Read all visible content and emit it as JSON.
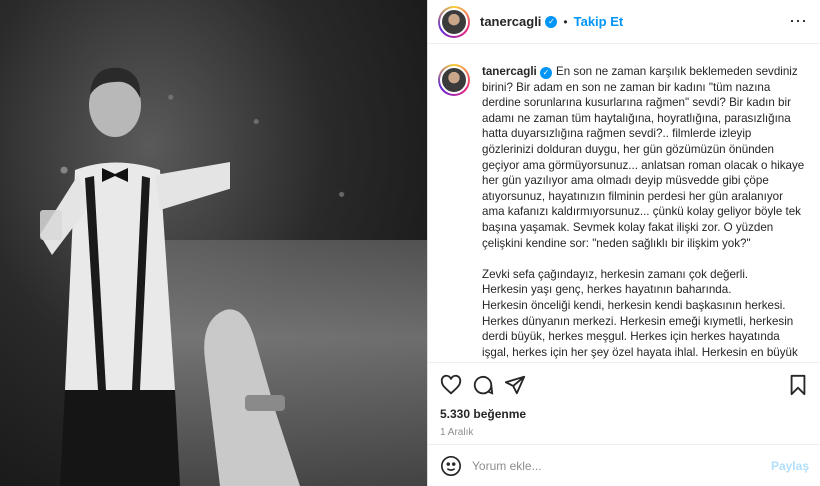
{
  "post": {
    "username": "tanercagli",
    "follow_label": "Takip Et",
    "dot": "•",
    "more": "⋯",
    "caption": "En son ne zaman karşılık beklemeden sevdiniz birini? Bir adam en son ne zaman bir kadını \"tüm nazına derdine sorunlarına kusurlarına rağmen\" sevdi? Bir kadın bir adamı ne zaman tüm haytalığına, hoyratlığına, parasızlığına hatta duyarsızlığına rağmen sevdi?.. filmlerde izleyip gözlerinizi dolduran duygu, her gün gözümüzün önünden geçiyor ama görmüyorsunuz... anlatsan roman olacak o hikaye her gün yazılıyor ama olmadı deyip müsvedde gibi çöpe atıyorsunuz, hayatınızın filminin perdesi her gün aralanıyor ama kafanızı kaldırmıyorsunuz... çünkü kolay geliyor böyle tek başına yaşamak. Sevmek kolay fakat ilişki zor. O yüzden çelişkini kendine sor: \"neden sağlıklı bir ilişkim yok?\"\n\nZevki sefa çağındayız, herkesin zamanı çok değerli.\nHerkesin yaşı genç, herkes hayatının baharında.\nHerkesin önceliği kendi, herkesin kendi başkasının herkesi.\nHerkes dünyanın merkezi. Herkesin emeği kıymetli, herkesin derdi büyük, herkes meşgul. Herkes için herkes hayatında işgal, herkes için her şey özel hayata ihlal. Herkesin en büyük şikayeti ihmal.. peki sen ne yaptın kardeşim diye sorduğunda? Herkes ölümüne inkar.",
    "likes": "5.330 beğenme",
    "date": "1 Aralık"
  },
  "comment": {
    "placeholder": "Yorum ekle...",
    "share_label": "Paylaş"
  },
  "colors": {
    "accent": "#0095f6",
    "share_disabled": "#b2dffc"
  },
  "icons": [
    "verified-icon",
    "more-options-icon",
    "heart-icon",
    "comment-icon",
    "share-icon",
    "bookmark-icon",
    "emoji-icon"
  ]
}
